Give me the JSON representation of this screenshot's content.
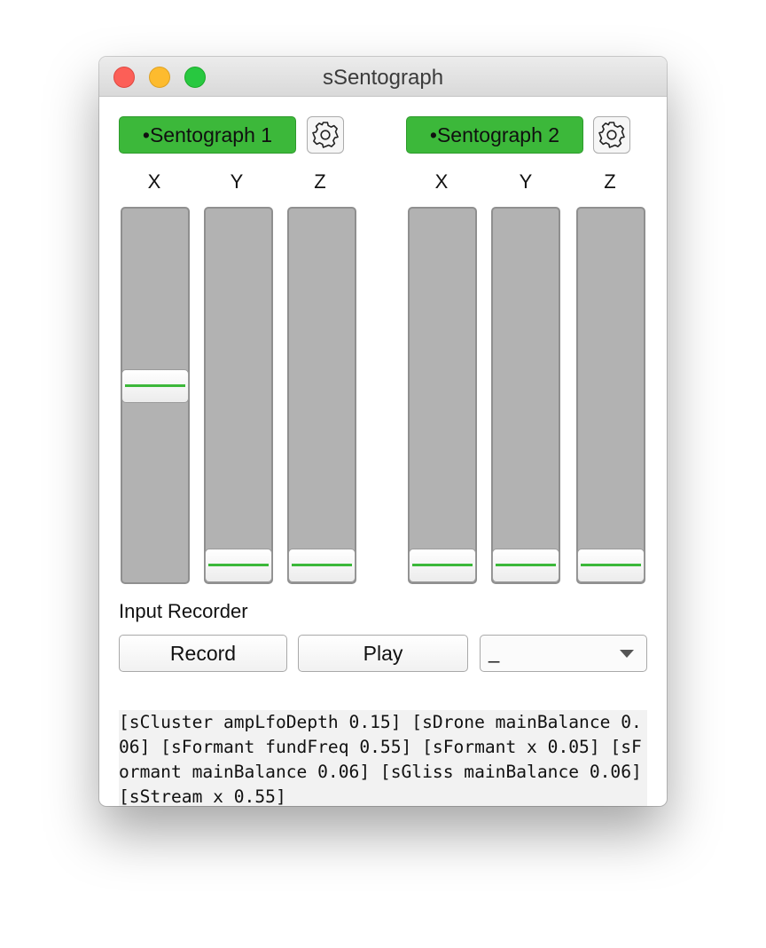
{
  "window": {
    "title": "sSentograph"
  },
  "devices": [
    {
      "label": "•Sentograph 1",
      "color": "#3cb83a",
      "sliders": [
        {
          "axis": "X",
          "value": 0.55
        },
        {
          "axis": "Y",
          "value": 0.05
        },
        {
          "axis": "Z",
          "value": 0.05
        }
      ]
    },
    {
      "label": "•Sentograph 2",
      "color": "#3cb83a",
      "sliders": [
        {
          "axis": "X",
          "value": 0.05
        },
        {
          "axis": "Y",
          "value": 0.05
        },
        {
          "axis": "Z",
          "value": 0.05
        }
      ]
    }
  ],
  "recorder": {
    "label": "Input Recorder",
    "record_label": "Record",
    "play_label": "Play",
    "selected": "_"
  },
  "log": {
    "text": "[sCluster ampLfoDepth 0.15] [sDrone mainBalance 0.06] [sFormant fundFreq 0.55] [sFormant x 0.05] [sFormant mainBalance 0.06] [sGliss mainBalance 0.06] [sStream x 0.55]"
  },
  "icons": {
    "close": "close-traffic-light",
    "minimize": "minimize-traffic-light",
    "zoom": "zoom-traffic-light",
    "settings": "gear-icon",
    "dropdown": "chevron-down-icon"
  }
}
